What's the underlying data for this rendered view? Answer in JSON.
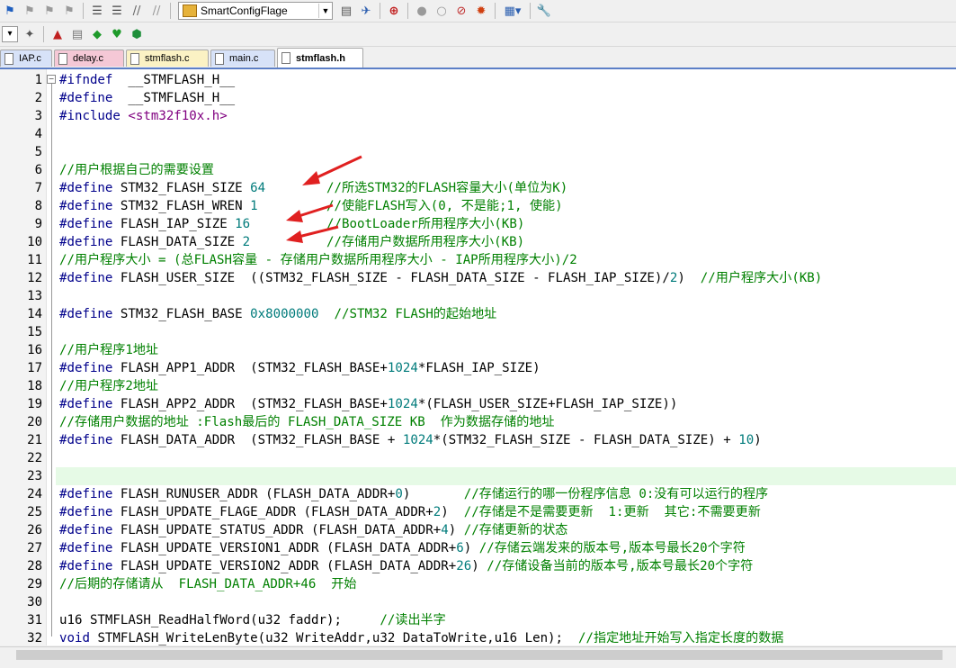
{
  "toolbar": {
    "target_combo": "SmartConfigFlage",
    "icons_row1": [
      "flag-icon",
      "bookmark-prev-icon",
      "bookmark-next-icon",
      "bookmark-clear-icon",
      "indent-icon",
      "unindent-icon",
      "comment-icon",
      "uncomment-icon",
      "target-icon",
      "find-in-files-icon",
      "debug-icon",
      "zoom-find-icon",
      "breakpoint-insert-icon",
      "breakpoint-enable-icon",
      "breakpoint-disable-icon",
      "breakpoint-kill-icon",
      "window-layout-icon",
      "configure-icon"
    ],
    "icons_row2": [
      "load-icon",
      "build-icon",
      "translate-icon",
      "rebuild-icon",
      "batch-build-icon",
      "download-icon",
      "options-icon"
    ]
  },
  "tabs": [
    {
      "label": "IAP.c",
      "color": "#d7e2f8",
      "active": false
    },
    {
      "label": "delay.c",
      "color": "#f5c8d6",
      "active": false
    },
    {
      "label": "stmflash.c",
      "color": "#fbf2c4",
      "active": false
    },
    {
      "label": "main.c",
      "color": "#d7e2f8",
      "active": false
    },
    {
      "label": "stmflash.h",
      "color": "#ffffff",
      "active": true
    }
  ],
  "editor": {
    "line_numbers": [
      "1",
      "2",
      "3",
      "4",
      "5",
      "6",
      "7",
      "8",
      "9",
      "10",
      "11",
      "12",
      "13",
      "14",
      "15",
      "16",
      "17",
      "18",
      "19",
      "20",
      "21",
      "22",
      "23",
      "24",
      "25",
      "26",
      "27",
      "28",
      "29",
      "30",
      "31",
      "32"
    ],
    "highlighted_line": "23",
    "lines": [
      [
        [
          "kw",
          "#ifndef"
        ],
        [
          "",
          "  __STMFLASH_H__"
        ]
      ],
      [
        [
          "kw",
          "#define"
        ],
        [
          "",
          "  __STMFLASH_H__"
        ]
      ],
      [
        [
          "kw",
          "#include"
        ],
        [
          "",
          " "
        ],
        [
          "st",
          "<stm32f10x.h>"
        ]
      ],
      [],
      [],
      [
        [
          "cm",
          "//用户根据自己的需要设置"
        ]
      ],
      [
        [
          "kw",
          "#define"
        ],
        [
          "",
          " STM32_FLASH_SIZE "
        ],
        [
          "nm",
          "64"
        ],
        [
          "",
          "        "
        ],
        [
          "cm",
          "//所选STM32的FLASH容量大小(单位为K)"
        ]
      ],
      [
        [
          "kw",
          "#define"
        ],
        [
          "",
          " STM32_FLASH_WREN "
        ],
        [
          "nm",
          "1"
        ],
        [
          "",
          "         "
        ],
        [
          "cm",
          "//使能FLASH写入(0, 不是能;1, 使能)"
        ]
      ],
      [
        [
          "kw",
          "#define"
        ],
        [
          "",
          " FLASH_IAP_SIZE "
        ],
        [
          "nm",
          "16"
        ],
        [
          "",
          "          "
        ],
        [
          "cm",
          "//BootLoader所用程序大小(KB)"
        ]
      ],
      [
        [
          "kw",
          "#define"
        ],
        [
          "",
          " FLASH_DATA_SIZE "
        ],
        [
          "nm",
          "2"
        ],
        [
          "",
          "          "
        ],
        [
          "cm",
          "//存储用户数据所用程序大小(KB)"
        ]
      ],
      [
        [
          "cm",
          "//用户程序大小 = (总FLASH容量 - 存储用户数据所用程序大小 - IAP所用程序大小)/2"
        ]
      ],
      [
        [
          "kw",
          "#define"
        ],
        [
          "",
          " FLASH_USER_SIZE  ((STM32_FLASH_SIZE - FLASH_DATA_SIZE - FLASH_IAP_SIZE)/"
        ],
        [
          "nm",
          "2"
        ],
        [
          "",
          ")  "
        ],
        [
          "cm",
          "//用户程序大小(KB)"
        ]
      ],
      [],
      [
        [
          "kw",
          "#define"
        ],
        [
          "",
          " STM32_FLASH_BASE "
        ],
        [
          "nm",
          "0x8000000"
        ],
        [
          "",
          "  "
        ],
        [
          "cm",
          "//STM32 FLASH的起始地址"
        ]
      ],
      [],
      [
        [
          "cm",
          "//用户程序1地址"
        ]
      ],
      [
        [
          "kw",
          "#define"
        ],
        [
          "",
          " FLASH_APP1_ADDR  (STM32_FLASH_BASE+"
        ],
        [
          "nm",
          "1024"
        ],
        [
          "",
          "*FLASH_IAP_SIZE)"
        ]
      ],
      [
        [
          "cm",
          "//用户程序2地址"
        ]
      ],
      [
        [
          "kw",
          "#define"
        ],
        [
          "",
          " FLASH_APP2_ADDR  (STM32_FLASH_BASE+"
        ],
        [
          "nm",
          "1024"
        ],
        [
          "",
          "*(FLASH_USER_SIZE+FLASH_IAP_SIZE))"
        ]
      ],
      [
        [
          "cm",
          "//存储用户数据的地址 :Flash最后的 FLASH_DATA_SIZE KB  作为数据存储的地址"
        ]
      ],
      [
        [
          "kw",
          "#define"
        ],
        [
          "",
          " FLASH_DATA_ADDR  (STM32_FLASH_BASE + "
        ],
        [
          "nm",
          "1024"
        ],
        [
          "",
          "*(STM32_FLASH_SIZE - FLASH_DATA_SIZE) + "
        ],
        [
          "nm",
          "10"
        ],
        [
          "",
          ")"
        ]
      ],
      [],
      [],
      [
        [
          "kw",
          "#define"
        ],
        [
          "",
          " FLASH_RUNUSER_ADDR (FLASH_DATA_ADDR+"
        ],
        [
          "nm",
          "0"
        ],
        [
          "",
          ")       "
        ],
        [
          "cm",
          "//存储运行的哪一份程序信息 0:没有可以运行的程序"
        ]
      ],
      [
        [
          "kw",
          "#define"
        ],
        [
          "",
          " FLASH_UPDATE_FLAGE_ADDR (FLASH_DATA_ADDR+"
        ],
        [
          "nm",
          "2"
        ],
        [
          "",
          ")  "
        ],
        [
          "cm",
          "//存储是不是需要更新  1:更新  其它:不需要更新"
        ]
      ],
      [
        [
          "kw",
          "#define"
        ],
        [
          "",
          " FLASH_UPDATE_STATUS_ADDR (FLASH_DATA_ADDR+"
        ],
        [
          "nm",
          "4"
        ],
        [
          "",
          ") "
        ],
        [
          "cm",
          "//存储更新的状态"
        ]
      ],
      [
        [
          "kw",
          "#define"
        ],
        [
          "",
          " FLASH_UPDATE_VERSION1_ADDR (FLASH_DATA_ADDR+"
        ],
        [
          "nm",
          "6"
        ],
        [
          "",
          ") "
        ],
        [
          "cm",
          "//存储云端发来的版本号,版本号最长20个字符"
        ]
      ],
      [
        [
          "kw",
          "#define"
        ],
        [
          "",
          " FLASH_UPDATE_VERSION2_ADDR (FLASH_DATA_ADDR+"
        ],
        [
          "nm",
          "26"
        ],
        [
          "",
          ") "
        ],
        [
          "cm",
          "//存储设备当前的版本号,版本号最长20个字符"
        ]
      ],
      [
        [
          "cm",
          "//后期的存储请从  FLASH_DATA_ADDR+46  开始"
        ]
      ],
      [],
      [
        [
          "",
          "u16 STMFLASH_ReadHalfWord(u32 faddr);     "
        ],
        [
          "cm",
          "//读出半字"
        ]
      ],
      [
        [
          "kw",
          "void"
        ],
        [
          "",
          " STMFLASH_WriteLenByte(u32 WriteAddr,u32 DataToWrite,u16 Len);  "
        ],
        [
          "cm",
          "//指定地址开始写入指定长度的数据"
        ]
      ]
    ]
  }
}
